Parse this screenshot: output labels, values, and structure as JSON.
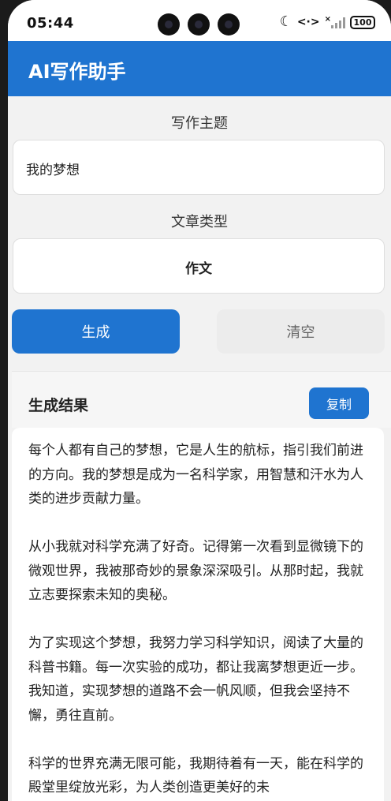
{
  "status_bar": {
    "time": "05:44",
    "code_icon_text": "<·>",
    "signal_mark": "×",
    "battery": "100"
  },
  "app_bar": {
    "title": "AI写作助手"
  },
  "form": {
    "topic_label": "写作主题",
    "topic_value": "我的梦想",
    "type_label": "文章类型",
    "type_value": "作文"
  },
  "actions": {
    "generate": "生成",
    "clear": "清空"
  },
  "result": {
    "title": "生成结果",
    "copy": "复制",
    "paragraphs": [
      "每个人都有自己的梦想，它是人生的航标，指引我们前进的方向。我的梦想是成为一名科学家，用智慧和汗水为人类的进步贡献力量。",
      "从小我就对科学充满了好奇。记得第一次看到显微镜下的微观世界，我被那奇妙的景象深深吸引。从那时起，我就立志要探索未知的奥秘。",
      "为了实现这个梦想，我努力学习科学知识，阅读了大量的科普书籍。每一次实验的成功，都让我离梦想更近一步。我知道，实现梦想的道路不会一帆风顺，但我会坚持不懈，勇往直前。",
      "科学的世界充满无限可能，我期待着有一天，能在科学的殿堂里绽放光彩，为人类创造更美好的未"
    ]
  },
  "colors": {
    "primary": "#1f74d0",
    "background": "#f2f2f2",
    "secondary_button": "#ececec"
  },
  "icons": [
    "moon-icon",
    "code-icon",
    "signal-icon",
    "battery-icon"
  ]
}
